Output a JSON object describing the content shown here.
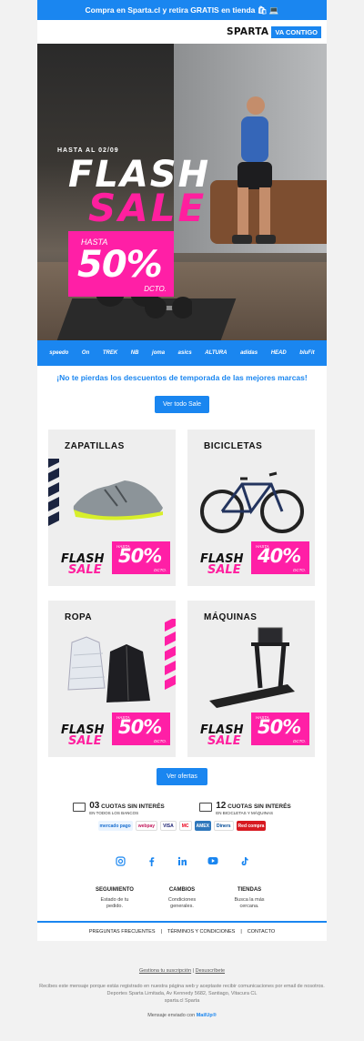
{
  "topbar": {
    "text": "Compra en Sparta.cl y retira GRATIS en tienda 🛍 💻"
  },
  "brand": {
    "name": "SPARTA",
    "tag": "VA CONTIGO"
  },
  "hero": {
    "date": "HASTA AL 02/09",
    "flash": "FLASH",
    "sale": "SALE",
    "hasta": "HASTA",
    "percent": "50%",
    "dcto": "DCTO."
  },
  "brands": [
    "speedo",
    "On",
    "TREK",
    "NB",
    "joma",
    "asics",
    "ALTURA",
    "adidas",
    "HEAD",
    "bluFit"
  ],
  "intro": "¡No te pierdas los descuentos de temporada de las mejores marcas!",
  "sale_button": "Ver todo Sale",
  "cards": [
    {
      "title": "ZAPATILLAS",
      "flash": "FLASH",
      "sale": "SALE",
      "hasta": "HASTA",
      "percent": "50%",
      "dcto": "DCTO."
    },
    {
      "title": "BICICLETAS",
      "flash": "FLASH",
      "sale": "SALE",
      "hasta": "HASTA",
      "percent": "40%",
      "dcto": "DCTO."
    },
    {
      "title": "ROPA",
      "flash": "FLASH",
      "sale": "SALE",
      "hasta": "HASTA",
      "percent": "50%",
      "dcto": "DCTO."
    },
    {
      "title": "MÁQUINAS",
      "flash": "FLASH",
      "sale": "SALE",
      "hasta": "HASTA",
      "percent": "50%",
      "dcto": "DCTO."
    }
  ],
  "offers_button": "Ver ofertas",
  "quotas": [
    {
      "count": "03",
      "label": "CUOTAS SIN INTERÉS",
      "sub": "EN TODOS LOS BANCOS"
    },
    {
      "count": "12",
      "label": "CUOTAS SIN INTERÉS",
      "sub": "EN BICICLETAS Y MÁQUINAS"
    }
  ],
  "payments": [
    "mercado pago",
    "webpay",
    "VISA",
    "MC",
    "AMEX",
    "Diners",
    "Red compra"
  ],
  "socials": [
    "instagram-icon",
    "facebook-icon",
    "linkedin-icon",
    "youtube-icon",
    "tiktok-icon"
  ],
  "help": [
    {
      "title": "SEGUIMIENTO",
      "text": "Estado de tu pedido."
    },
    {
      "title": "CAMBIOS",
      "text": "Condiciones generales."
    },
    {
      "title": "TIENDAS",
      "text": "Busca la más cercana."
    }
  ],
  "footer_links": [
    "PREGUNTAS FRECUENTES",
    "TÉRMINOS Y CONDICIONES",
    "CONTACTO"
  ],
  "legal": {
    "manage": "Gestiona tu suscripción",
    "unsubscribe": "Desuscríbete",
    "line1": "Recibes este mensaje porque estás registrado en nuestra página web y aceptaste recibir comunicaciones por email de nosotros.",
    "line2": "Deportes Sparta Limitada, Av Kennedy 5682, Santiago, Vitacura CL",
    "line3": "sparta.cl Sparta",
    "sent_prefix": "Mensaje enviado con",
    "sent_brand": "MailUp®"
  },
  "colors": {
    "accent": "#1a86f0",
    "magenta": "#ff1fa6"
  }
}
